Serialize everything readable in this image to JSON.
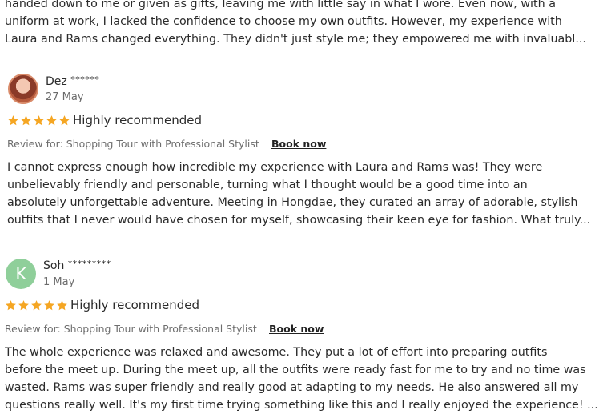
{
  "previous_review": {
    "lines": [
      "handed down to me or given as gifts, leaving me with little say in what I wore. Even now, with a",
      "uniform at work, I lacked the confidence to choose my own outfits. However, my experience with",
      "Laura and Rams changed everything. They didn't just style me; they empowered me with invaluabl..."
    ]
  },
  "reviews": [
    {
      "name": "Dez",
      "masked": "******",
      "date": "27 May",
      "rating": 5,
      "rating_label": "Highly recommended",
      "review_for": "Review for: Shopping Tour with Professional Stylist",
      "book_label": "Book now",
      "lines": [
        "I cannot express enough how incredible my experience with Laura and Rams was! They were",
        "unbelievably friendly and personable, turning what I thought would be a good time into an",
        "absolutely unforgettable adventure. Meeting in Hongdae, they curated an array of adorable, stylish",
        "outfits that I never would have chosen for myself, showcasing their keen eye for fashion. What truly..."
      ]
    },
    {
      "name": "Soh",
      "masked": "*********",
      "avatar_letter": "K",
      "date": "1 May",
      "rating": 5,
      "rating_label": "Highly recommended",
      "review_for": "Review for: Shopping Tour with Professional Stylist",
      "book_label": "Book now",
      "lines": [
        "The whole experience was relaxed and awesome. They put a lot of effort into preparing outfits",
        "before the meet up. During the meet up, all the outfits were ready fast for me to try and no time was",
        "wasted. Rams was super friendly and really good at adapting to my needs. He also answered all my",
        "questions really well. It's my first time trying something like this and I really enjoyed the experience! ..."
      ]
    }
  ],
  "colors": {
    "star": "#f5a623",
    "avatar_green": "#8fcf9a"
  }
}
